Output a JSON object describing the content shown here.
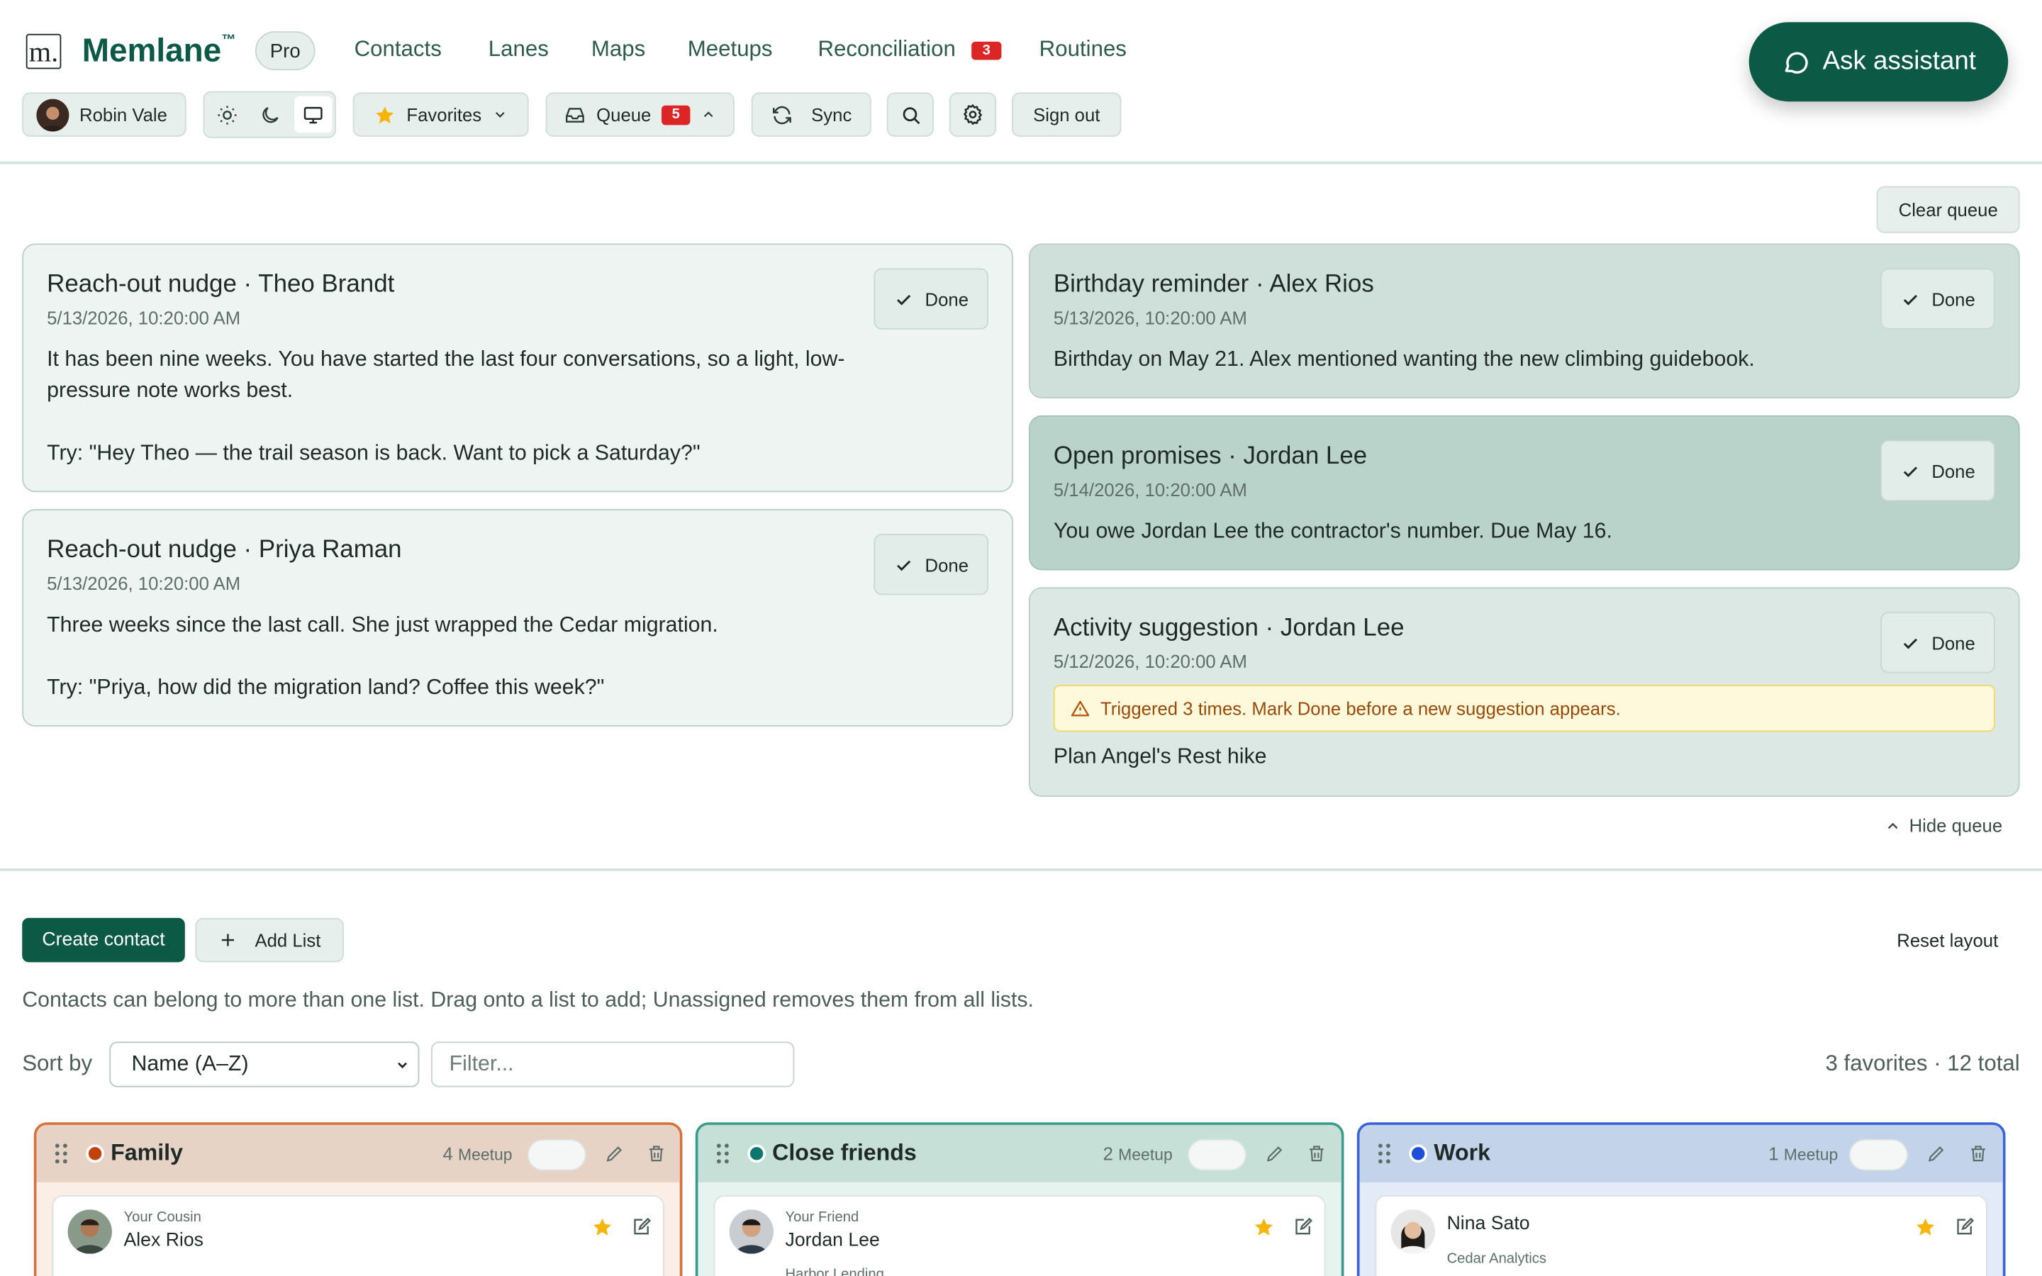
{
  "app": {
    "logo_letter": "m.",
    "name": "Memlane",
    "tm": "™",
    "plan_badge": "Pro"
  },
  "nav": {
    "items": [
      "Contacts",
      "Lanes",
      "Maps",
      "Meetups",
      "Reconciliation",
      "Routines"
    ],
    "reconciliation_badge": "3"
  },
  "assistant": {
    "label": "Ask assistant"
  },
  "toolbar": {
    "user_name": "Robin Vale",
    "favorites_label": "Favorites",
    "queue_label": "Queue",
    "queue_badge": "5",
    "sync_label": "Sync",
    "signout_label": "Sign out"
  },
  "queue": {
    "clear_label": "Clear queue",
    "hide_label": "Hide queue",
    "done_label": "Done",
    "left": [
      {
        "title": "Reach-out nudge · Theo Brandt",
        "date": "5/13/2026, 10:20:00 AM",
        "body1": "It has been nine weeks. You have started the last four conversations, so a light, low-",
        "body2": "pressure note works best.",
        "body3": "Try: \"Hey Theo — the trail season is back. Want to pick a Saturday?\""
      },
      {
        "title": "Reach-out nudge · Priya Raman",
        "date": "5/13/2026, 10:20:00 AM",
        "body1": "Three weeks since the last call. She just wrapped the Cedar migration.",
        "body3": "Try: \"Priya, how did the migration land? Coffee this week?\""
      }
    ],
    "right": [
      {
        "title": "Birthday reminder · Alex Rios",
        "date": "5/13/2026, 10:20:00 AM",
        "body1": "Birthday on May 21. Alex mentioned wanting the new climbing guidebook."
      },
      {
        "title": "Open promises · Jordan Lee",
        "date": "5/14/2026, 10:20:00 AM",
        "body1": "You owe Jordan Lee the contractor's number. Due May 16."
      },
      {
        "title": "Activity suggestion · Jordan Lee",
        "date": "5/12/2026, 10:20:00 AM",
        "warning": "Triggered 3 times. Mark Done before a new suggestion appears.",
        "body1": "Plan Angel's Rest hike"
      }
    ]
  },
  "board": {
    "create_label": "Create contact",
    "add_list_label": "Add List",
    "reset_label": "Reset layout",
    "help_text": "Contacts can belong to more than one list. Drag onto a list to add; Unassigned removes them from all lists.",
    "sort_label": "Sort by",
    "sort_value": "Name (A–Z)",
    "filter_placeholder": "Filter...",
    "totals": "3 favorites · 12 total",
    "meetup_label": "Meetup",
    "lists": [
      {
        "name": "Family",
        "count": "4",
        "dot": "#c2410c",
        "border": "#d9703c",
        "head_bg": "#e6d3c6",
        "body_bg": "#fbeee6",
        "card": {
          "relation": "Your Cousin",
          "name": "Alex Rios",
          "sub": ""
        }
      },
      {
        "name": "Close friends",
        "count": "2",
        "dot": "#0f766e",
        "border": "#3b9c8c",
        "head_bg": "#c6e0d8",
        "body_bg": "#e6f3ef",
        "card": {
          "relation": "Your Friend",
          "name": "Jordan Lee",
          "sub": "Harbor Lending"
        }
      },
      {
        "name": "Work",
        "count": "1",
        "dot": "#1d4ed8",
        "border": "#3b63d8",
        "head_bg": "#c3d3ea",
        "body_bg": "#e3ebf8",
        "card": {
          "relation": "",
          "name": "Nina Sato",
          "sub": "Cedar Analytics"
        }
      }
    ]
  },
  "colors": {
    "brand": "#0c5a45",
    "badge_red": "#dc2626",
    "star": "#f5b50a"
  }
}
